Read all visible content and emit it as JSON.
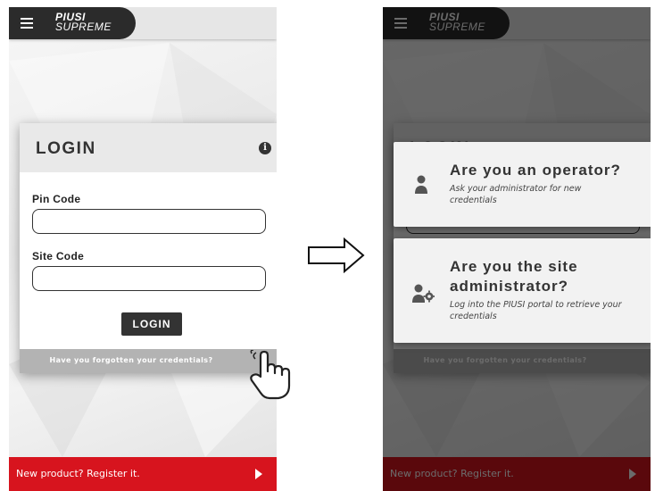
{
  "app": {
    "brand_line1": "PIUSI",
    "brand_line2": "SUPREME"
  },
  "login": {
    "title": "LOGIN",
    "pin_label": "Pin Code",
    "pin_value": "",
    "site_label": "Site Code",
    "site_value": "",
    "button_label": "LOGIN",
    "forgot_link": "Have you forgotten your credentials?"
  },
  "footer": {
    "register_text": "New product? Register it."
  },
  "popups": {
    "operator": {
      "title": "Are you an operator?",
      "description": "Ask your administrator for new credentials",
      "icon": "user-icon"
    },
    "admin": {
      "title_line1": "Are you the site",
      "title_line2": "administrator?",
      "description": "Log into the PIUSI portal to retrieve your credentials",
      "icon": "user-gear-icon"
    }
  },
  "colors": {
    "accent_red": "#d7141e",
    "dark": "#2b2b2b",
    "card_header": "#e9e9e9",
    "forgot_bar": "#b3b3b3"
  }
}
